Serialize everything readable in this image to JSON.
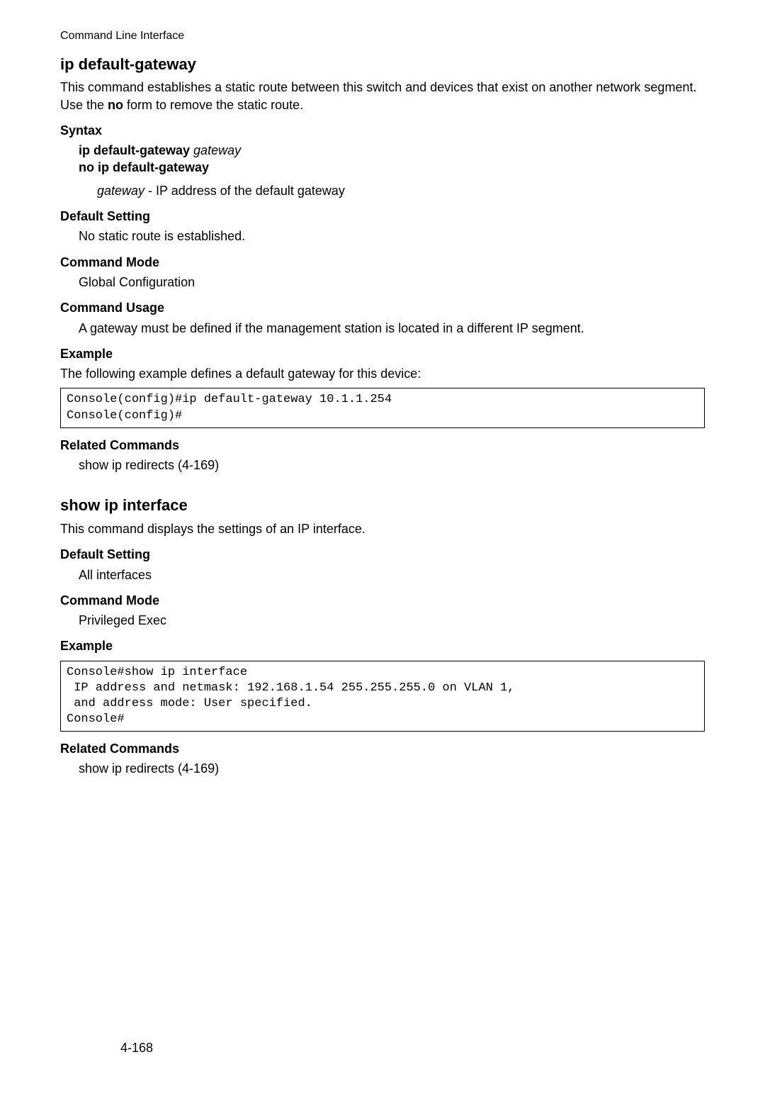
{
  "header": "Command Line Interface",
  "cmd1": {
    "title": "ip default-gateway",
    "intro_pre": "This command establishes a static route between this switch and devices that exist on another network segment. Use the ",
    "intro_bold": "no",
    "intro_post": " form to remove the static route.",
    "syntax_label": "Syntax",
    "syntax_line1_cmd": "ip default-gateway",
    "syntax_line1_arg": "gateway",
    "syntax_line2": "no ip default-gateway",
    "syntax_param_name": "gateway",
    "syntax_param_desc": " - IP address of the default gateway",
    "default_label": "Default Setting",
    "default_text": "No static route is established.",
    "mode_label": "Command Mode",
    "mode_text": "Global Configuration",
    "usage_label": "Command Usage",
    "usage_text": "A gateway must be defined if the management station is located in a different IP segment.",
    "example_label": "Example",
    "example_intro": "The following example defines a default gateway for this device:",
    "example_code": "Console(config)#ip default-gateway 10.1.1.254\nConsole(config)#",
    "related_label": "Related Commands",
    "related_text": "show ip redirects (4-169)"
  },
  "cmd2": {
    "title": "show ip interface",
    "intro": "This command displays the settings of an IP interface.",
    "default_label": "Default Setting",
    "default_text": "All interfaces",
    "mode_label": "Command Mode",
    "mode_text": "Privileged Exec",
    "example_label": "Example",
    "example_code": "Console#show ip interface\n IP address and netmask: 192.168.1.54 255.255.255.0 on VLAN 1,\n and address mode: User specified.\nConsole#",
    "related_label": "Related Commands",
    "related_text": "show ip redirects (4-169)"
  },
  "page_number": "4-168"
}
